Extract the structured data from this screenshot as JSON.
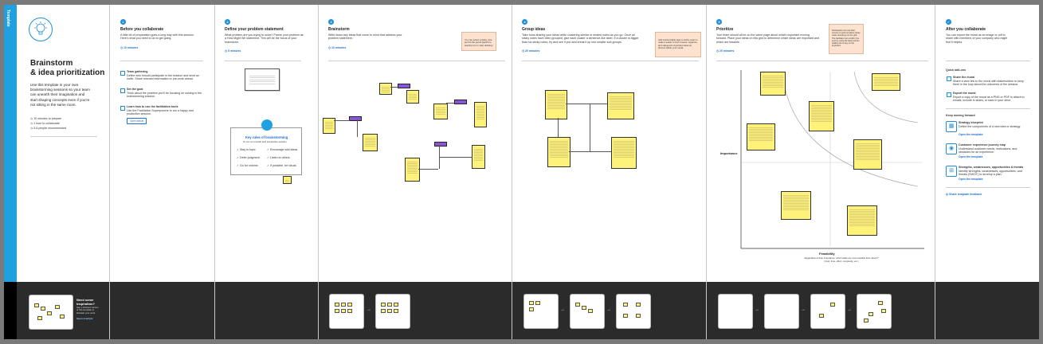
{
  "sidebar": {
    "label": "Template"
  },
  "intro": {
    "title_line1": "Brainstorm",
    "title_line2": "& idea prioritization",
    "description": "Use this template in your own brainstorming sessions so your team can unearth their imagination and start shaping concepts even if you're not sitting in the same room.",
    "meta": [
      "10 minutes to prepare",
      "1 hour to collaborate",
      "3-8 people recommended"
    ]
  },
  "before": {
    "step": "1",
    "title": "Before you collaborate",
    "description": "A little bit of preparation goes a long way with this session. Here's what you need to do to get going.",
    "time": "10 minutes",
    "items": [
      {
        "title": "Team gathering",
        "text": "Define who should participate in the session and send an invite. Share relevant information or pre-work ahead."
      },
      {
        "title": "Set the goal",
        "text": "Think about the problem you'll be focusing on solving in the brainstorming session."
      },
      {
        "title": "Learn how to use the facilitation tools",
        "text": "Use the Facilitation Superpowers to run a happy and productive session."
      }
    ],
    "link": "Open article"
  },
  "define": {
    "step": "2",
    "title": "Define your problem statement",
    "description": "What problem are you trying to solve? Frame your problem as a How Might We statement. This will be the focus of your brainstorm.",
    "time": "5 minutes",
    "card_title": "Key rules of brainstorming",
    "card_sub": "To run an smooth and productive session",
    "rules": [
      "Stay in topic.",
      "Encourage wild ideas.",
      "Defer judgment.",
      "Listen to others.",
      "Go for volume.",
      "If possible, be visual."
    ]
  },
  "brainstorm": {
    "step": "3",
    "title": "Brainstorm",
    "description": "Write down any ideas that come to mind that address your problem statement.",
    "time": "10 minutes",
    "tip": "You can select a sticky note and hit the pencil [switch to sketch] icon to start drawing!"
  },
  "group": {
    "step": "4",
    "title": "Group ideas",
    "description": "Take turns sharing your ideas while clustering similar or related notes as you go. Once all sticky notes have been grouped, give each cluster a sentence-like label. If a cluster is bigger than six sticky notes, try and see if you and break it up into smaller sub-groups.",
    "time": "20 minutes",
    "tip": "Add customizable tags to sticky notes to make it easier to find, browse, organize, and categorize important ideas as themes within your mural."
  },
  "prioritize": {
    "step": "5",
    "title": "Prioritize",
    "description": "Your team should all be on the same page about what's important moving forward. Place your ideas on this grid to determine which ideas are important and which are feasible.",
    "time": "20 minutes",
    "tip": "Participants can use their cursors to point at where sticky notes should go on the grid. The facilitator can confirm the spot by using the laser pointer holding the H key on the keyboard.",
    "y_label": "Importance",
    "x_label": "Feasibility",
    "x_caption": "Regardless of their importance, which tasks are more feasible than others? (Cost, time, effort, complexity, etc.)"
  },
  "after": {
    "title": "After you collaborate",
    "description": "You can export the mural as an image or pdf to share with members of your company who might find it helpful.",
    "quick_title": "Quick add-ons",
    "quick": [
      {
        "title": "Share the mural",
        "text": "Share a view link to the mural with stakeholders to keep them in the loop about the outcomes of the session."
      },
      {
        "title": "Export the mural",
        "text": "Export a copy of the mural as a PNG or PDF to attach to emails, include in slides, or save in your drive."
      }
    ],
    "forward_title": "Keep moving forward",
    "forward": [
      {
        "title": "Strategy blueprint",
        "text": "Define the components of a new idea or strategy.",
        "link": "Open the template"
      },
      {
        "title": "Customer experience journey map",
        "text": "Understand customer needs, motivations, and obstacles for an experience.",
        "link": "Open the template"
      },
      {
        "title": "Strengths, weaknesses, opportunities & threats",
        "text": "Identify strengths, weaknesses, opportunities, and threats (SWOT) to develop a plan.",
        "link": "Open the template"
      }
    ],
    "feedback": "Share template feedback"
  },
  "footer": {
    "need_title": "Need some inspiration?",
    "need_text": "See a finished version of this template to kickstart your work.",
    "need_button": "Open example"
  }
}
